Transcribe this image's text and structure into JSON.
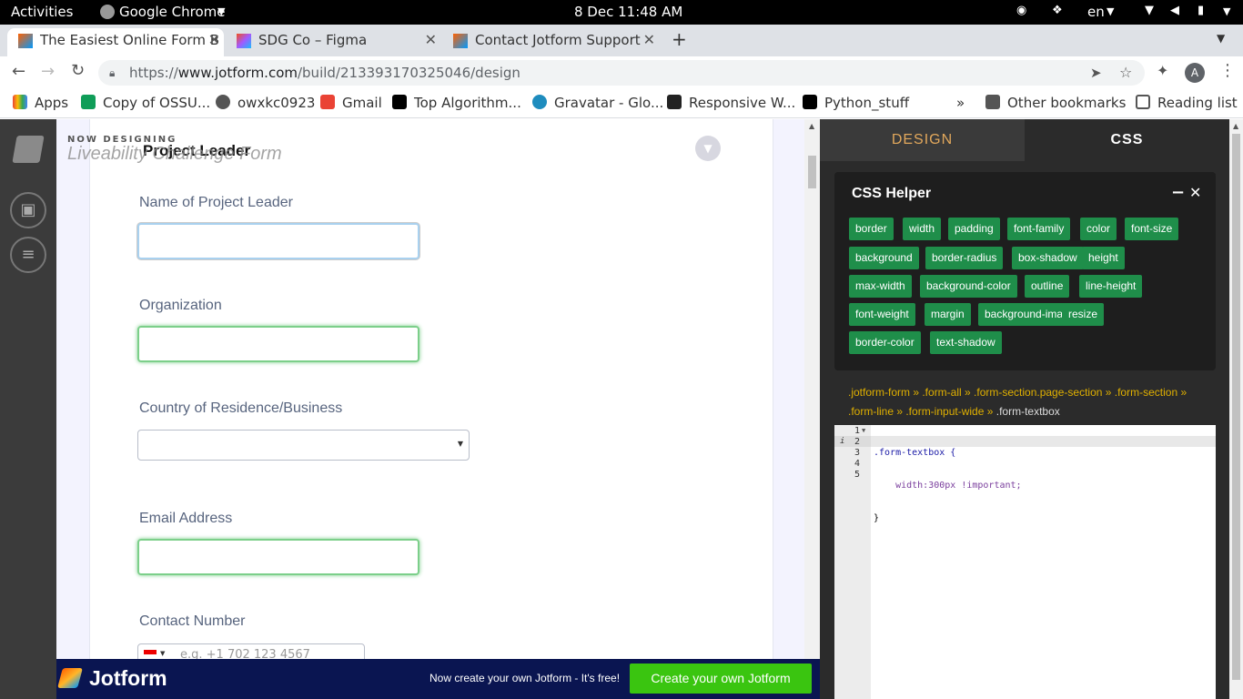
{
  "os": {
    "activities": "Activities",
    "app_name": "Google Chrome",
    "clock": "8 Dec  11:48 AM",
    "lang": "en"
  },
  "tabs": [
    {
      "title": "The Easiest Online Form B"
    },
    {
      "title": "SDG Co – Figma"
    },
    {
      "title": "Contact Jotform Support"
    }
  ],
  "toolbar": {
    "url_prefix": "https://",
    "url_host": "www.jotform.com",
    "url_path": "/build/213393170325046/design",
    "avatar": "A"
  },
  "bookmarks": [
    {
      "label": "Apps"
    },
    {
      "label": "Copy of OSSU..."
    },
    {
      "label": "owxkc0923"
    },
    {
      "label": "Gmail"
    },
    {
      "label": "Top Algorithm..."
    },
    {
      "label": "Gravatar - Glo..."
    },
    {
      "label": "Responsive W..."
    },
    {
      "label": "Python_stuff"
    }
  ],
  "bookmarks_more": "»",
  "bookmarks_other": "Other bookmarks",
  "bookmarks_reading": "Reading list",
  "designer": {
    "now_designing": "NOW DESIGNING",
    "form_name": "Liveability Challenge Form"
  },
  "form": {
    "section_title": "Project Leader",
    "fields": [
      {
        "label": "Name of Project Leader"
      },
      {
        "label": "Organization"
      },
      {
        "label": "Country of Residence/Business"
      },
      {
        "label": "Email Address"
      },
      {
        "label": "Contact Number",
        "placeholder": "e.g. +1 702 123 4567"
      }
    ]
  },
  "promo": {
    "logo": "Jotform",
    "text": "Now create your own Jotform - It's free!",
    "button": "Create your own Jotform"
  },
  "panel": {
    "tab_design": "DESIGN",
    "tab_css": "CSS",
    "helper_title": "CSS Helper",
    "chips": [
      "border",
      "width",
      "padding",
      "font-family",
      "color",
      "font-size",
      "background",
      "border-radius",
      "box-shadow",
      "height",
      "max-width",
      "background-color",
      "outline",
      "line-height",
      "font-weight",
      "margin",
      "background-image",
      "resize",
      "border-color",
      "text-shadow"
    ],
    "breadcrumb_line1": ".jotform-form » .form-all » .form-section.page-section » .form-section »",
    "breadcrumb_line2_a": ".form-line » .form-input-wide » ",
    "breadcrumb_line2_b": ".form-textbox",
    "line_numbers": [
      "1",
      "2",
      "3",
      "4",
      "5"
    ],
    "code": [
      ".form-textbox {",
      "    width:300px !important;",
      "}",
      "",
      ""
    ]
  },
  "colors": {
    "green_chip": "#1f8e4a",
    "promo_bg": "#0a1551",
    "promo_button": "#3ac510"
  }
}
